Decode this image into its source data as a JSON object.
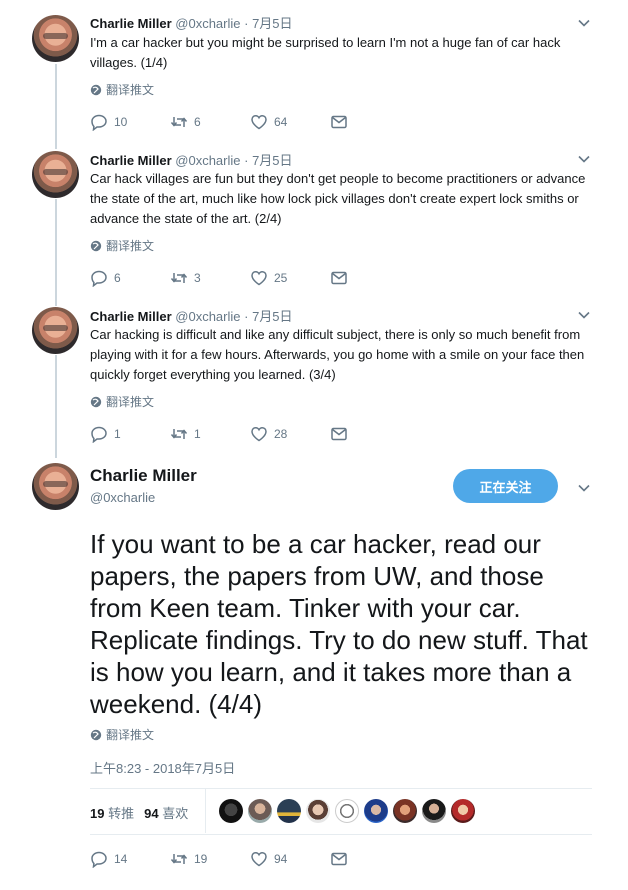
{
  "translate_label": "翻译推文",
  "colors": {
    "accent": "#4fa8e8",
    "muted": "#657786",
    "text": "#14171a"
  },
  "tweets": [
    {
      "name": "Charlie Miller",
      "handle": "@0xcharlie",
      "date": "· 7月5日",
      "text": "I'm a car hacker but you might be surprised to learn I'm not a huge fan of car hack villages. (1/4)",
      "replies": "10",
      "retweets": "6",
      "likes": "64"
    },
    {
      "name": "Charlie Miller",
      "handle": "@0xcharlie",
      "date": "· 7月5日",
      "text": "Car hack villages are fun but they don't get people to become practitioners or advance the state of the art, much like how lock pick villages don't create expert lock smiths or advance the state of the art. (2/4)",
      "replies": "6",
      "retweets": "3",
      "likes": "25"
    },
    {
      "name": "Charlie Miller",
      "handle": "@0xcharlie",
      "date": "· 7月5日",
      "text": "Car hacking is difficult and like any difficult subject, there is only so much benefit from playing with it for a few hours.  Afterwards, you go home with a smile on your face then quickly forget everything you learned. (3/4)",
      "replies": "1",
      "retweets": "1",
      "likes": "28"
    }
  ],
  "main_tweet": {
    "name": "Charlie Miller",
    "handle": "@0xcharlie",
    "follow_label": "正在关注",
    "text": "If you want to be a car hacker, read our papers, the papers from UW, and those from Keen team.  Tinker with your car. Replicate findings.  Try to do new stuff.  That is how you learn, and it takes more than a weekend. (4/4)",
    "timestamp": "上午8:23 - 2018年7月5日",
    "retweet_count": "19",
    "retweet_label": "转推",
    "like_count": "94",
    "like_label": "喜欢",
    "replies": "14",
    "retweets": "19",
    "likes": "94"
  },
  "likers": [
    "liker-1",
    "liker-2",
    "liker-3",
    "liker-4",
    "liker-5",
    "liker-6",
    "liker-7",
    "liker-8",
    "liker-9"
  ]
}
